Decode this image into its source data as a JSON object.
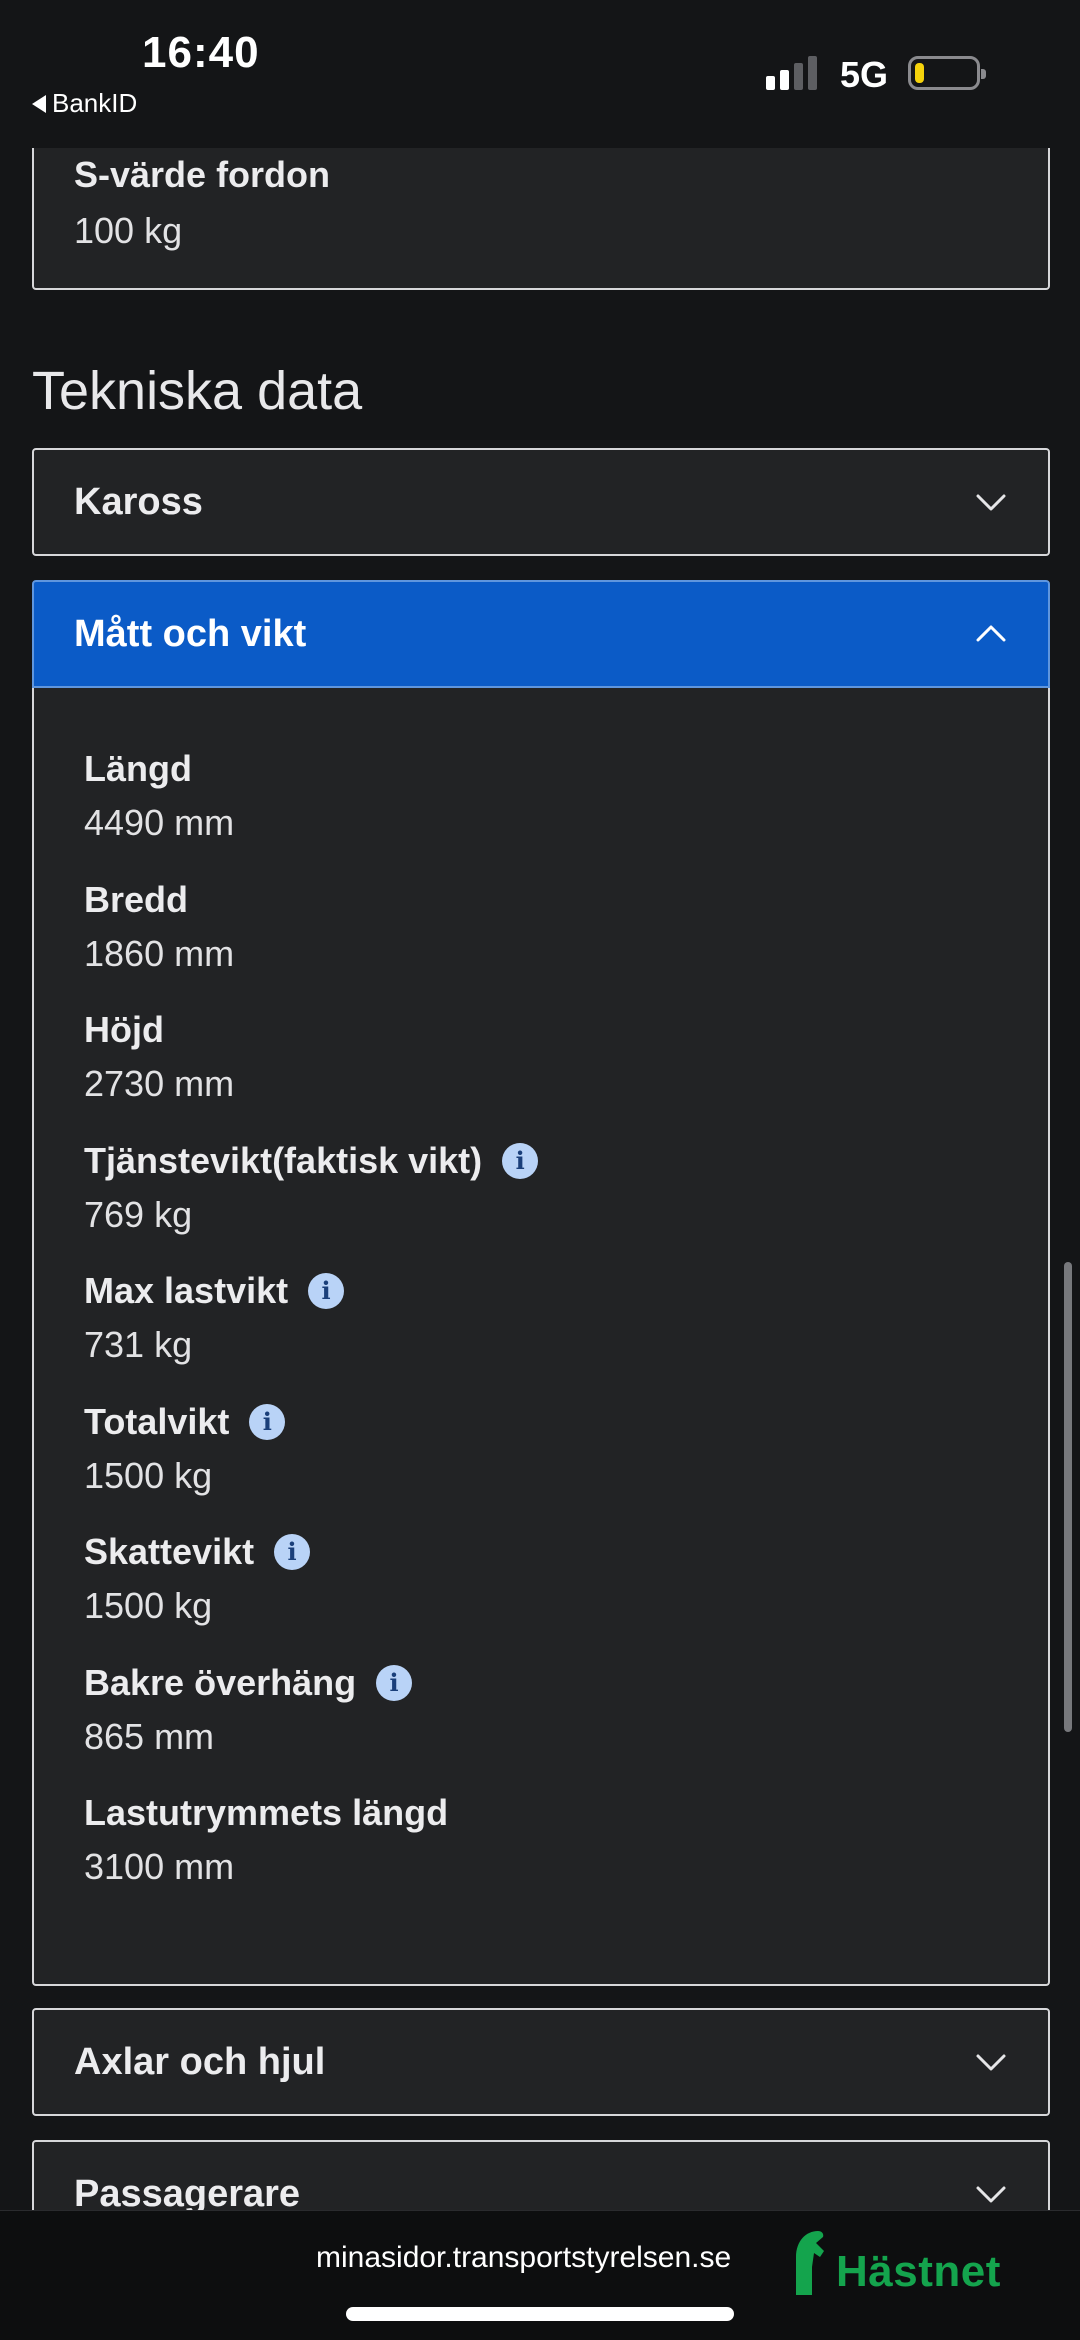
{
  "status_bar": {
    "time": "16:40",
    "back_app": "BankID",
    "network": "5G",
    "colors": {
      "battery_fill": "#f5d20b"
    }
  },
  "top_card": {
    "label": "S-värde fordon",
    "value": "100 kg"
  },
  "section_title": "Tekniska data",
  "accordions": [
    {
      "label": "Kaross",
      "expanded": false
    },
    {
      "label": "Mått och vikt",
      "expanded": true
    },
    {
      "label": "Axlar och hjul",
      "expanded": false
    },
    {
      "label": "Passagerare",
      "expanded": false
    }
  ],
  "details": [
    {
      "label": "Längd",
      "value": "4490 mm",
      "info": false
    },
    {
      "label": "Bredd",
      "value": "1860 mm",
      "info": false
    },
    {
      "label": "Höjd",
      "value": "2730 mm",
      "info": false
    },
    {
      "label": "Tjänstevikt(faktisk vikt)",
      "value": "769 kg",
      "info": true
    },
    {
      "label": "Max lastvikt",
      "value": "731 kg",
      "info": true
    },
    {
      "label": "Totalvikt",
      "value": "1500 kg",
      "info": true
    },
    {
      "label": "Skattevikt",
      "value": "1500 kg",
      "info": true
    },
    {
      "label": "Bakre överhäng",
      "value": "865 mm",
      "info": true
    },
    {
      "label": "Lastutrymmets längd",
      "value": "3100 mm",
      "info": false
    }
  ],
  "info_icon_glyph": "i",
  "bottom_bar": {
    "url": "minasidor.transportstyrelsen.se",
    "brand": "Hästnet"
  },
  "colors": {
    "accent": "#0b5bc7",
    "background": "#141517",
    "card": "#222325",
    "brand": "#14a44d",
    "info_icon": "#b9d3f7"
  }
}
